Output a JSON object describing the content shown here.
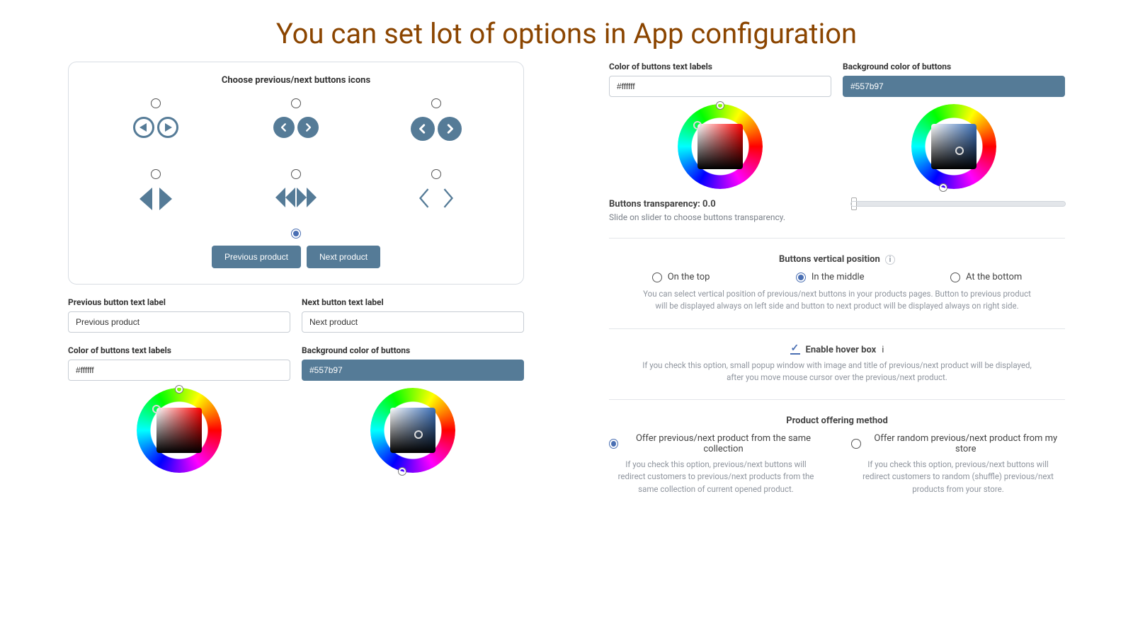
{
  "page_title": "You can set lot of options in App configuration",
  "left": {
    "card_title": "Choose previous/next buttons icons",
    "icon_options": [
      1,
      2,
      3,
      4,
      5,
      6
    ],
    "selected_icon_index": 6,
    "preview_prev": "Previous product",
    "preview_next": "Next product",
    "prev_label_title": "Previous button text label",
    "next_label_title": "Next button text label",
    "prev_label_value": "Previous product",
    "next_label_value": "Next product",
    "text_color_title": "Color of buttons text labels",
    "bg_color_title": "Background color of buttons",
    "text_color_value": "#ffffff",
    "bg_color_value": "#557b97"
  },
  "right": {
    "text_color_title": "Color of buttons text labels",
    "bg_color_title": "Background color of buttons",
    "text_color_value": "#ffffff",
    "bg_color_value": "#557b97",
    "transparency_label": "Buttons transparency: 0.0",
    "transparency_desc": "Slide on slider to choose buttons transparency.",
    "transparency_value": 0,
    "vpos_heading": "Buttons vertical position",
    "vpos_options": {
      "top": "On the top",
      "middle": "In the middle",
      "bottom": "At the bottom"
    },
    "vpos_selected": "middle",
    "vpos_desc": "You can select vertical position of previous/next buttons in your products pages. Button to previous product will be displayed always on left side and button to next product will be displayed always on right side.",
    "hover_label": "Enable hover box",
    "hover_checked": true,
    "hover_desc": "If you check this option, small popup window with image and title of previous/next product will be displayed, after you move mouse cursor over the previous/next product.",
    "offer_heading": "Product offering method",
    "offer_a_label": "Offer previous/next product from the same collection",
    "offer_a_desc": "If you check this option, previous/next buttons will redirect customers to previous/next products from the same collection of current opened product.",
    "offer_b_label": "Offer random previous/next product from my store",
    "offer_b_desc": "If you check this option, previous/next buttons will redirect customers to random (shuffle) previous/next products from your store.",
    "offer_selected": "a"
  }
}
